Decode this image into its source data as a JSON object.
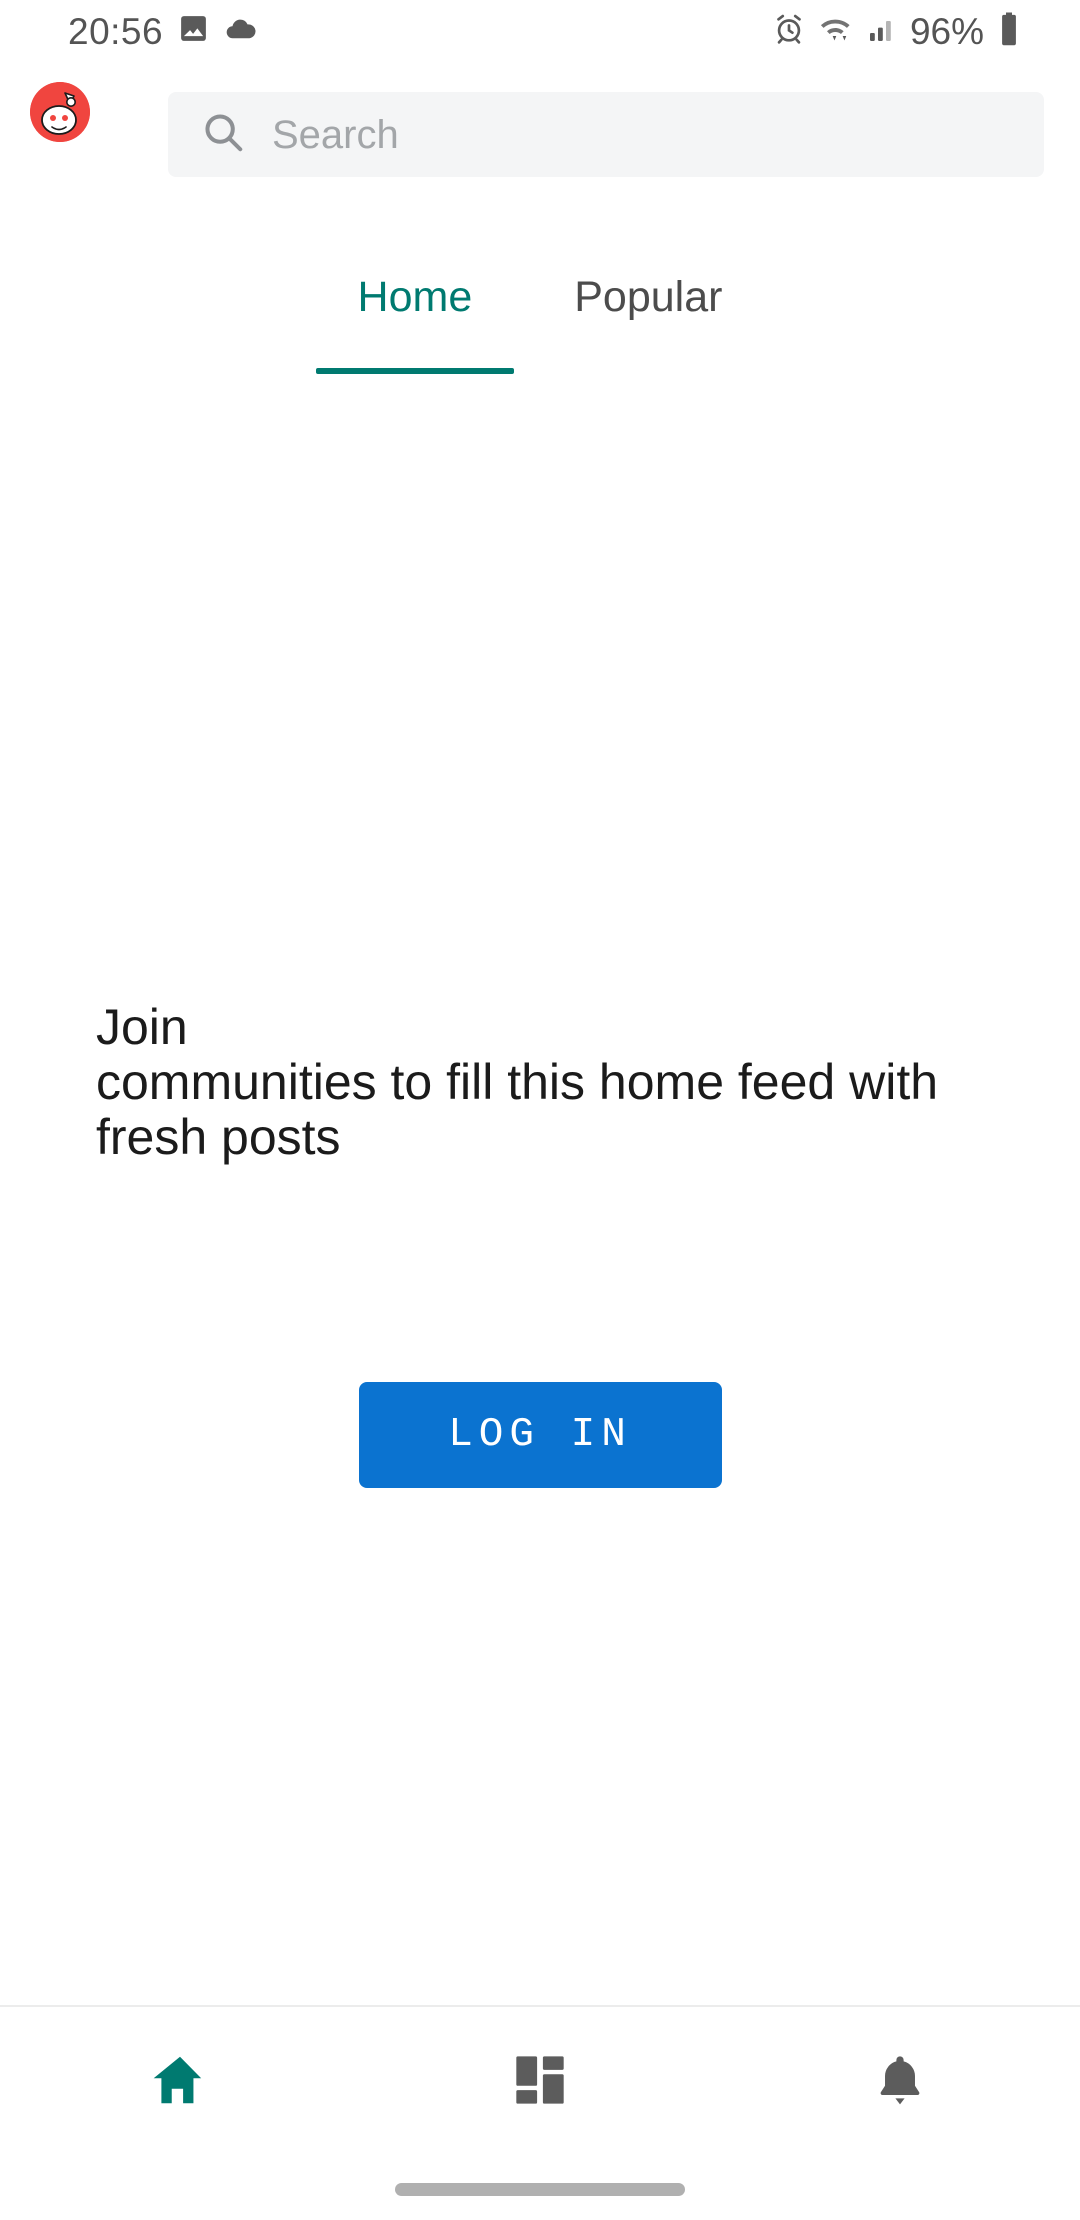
{
  "status_bar": {
    "time": "20:56",
    "battery_percent": "96%",
    "left_icons": [
      "image-icon",
      "cloud-icon"
    ],
    "right_icons": [
      "alarm-icon",
      "wifi-icon",
      "signal-icon",
      "battery-icon"
    ]
  },
  "top_bar": {
    "avatar_name": "reddit-snoo-avatar",
    "avatar_color": "#f0453f",
    "search": {
      "placeholder": "Search",
      "value": "",
      "icon": "search-icon",
      "background": "#f4f5f6"
    }
  },
  "tabs": {
    "active_index": 0,
    "accent_color": "#007a70",
    "items": [
      {
        "label": "Home",
        "name": "tab-home"
      },
      {
        "label": "Popular",
        "name": "tab-popular"
      }
    ]
  },
  "main": {
    "empty_feed_message": "Join\ncommunities to fill this home feed with fresh posts",
    "login_button": {
      "label": "LOG IN",
      "color": "#0b73d0",
      "text_color": "#ffffff"
    }
  },
  "bottom_nav": {
    "active_index": 0,
    "active_color": "#007a70",
    "inactive_color": "#5c5c5c",
    "items": [
      {
        "name": "nav-home",
        "icon": "home-icon"
      },
      {
        "name": "nav-communities",
        "icon": "grid-icon"
      },
      {
        "name": "nav-notifications",
        "icon": "bell-icon"
      }
    ]
  },
  "system": {
    "gesture_bar": "gesture-bar"
  }
}
